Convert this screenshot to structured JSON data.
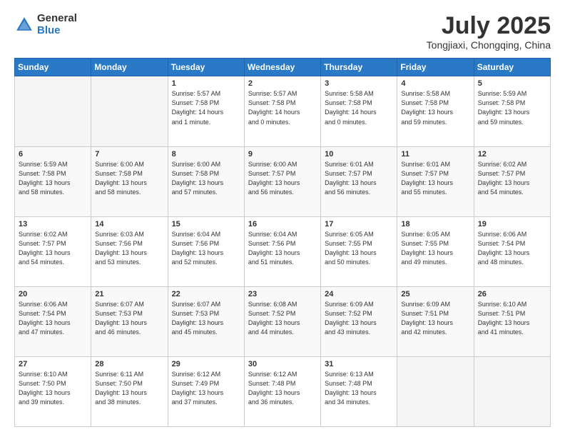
{
  "header": {
    "logo_general": "General",
    "logo_blue": "Blue",
    "month_title": "July 2025",
    "location": "Tongjiaxi, Chongqing, China"
  },
  "weekdays": [
    "Sunday",
    "Monday",
    "Tuesday",
    "Wednesday",
    "Thursday",
    "Friday",
    "Saturday"
  ],
  "weeks": [
    [
      {
        "day": "",
        "text": ""
      },
      {
        "day": "",
        "text": ""
      },
      {
        "day": "1",
        "text": "Sunrise: 5:57 AM\nSunset: 7:58 PM\nDaylight: 14 hours\nand 1 minute."
      },
      {
        "day": "2",
        "text": "Sunrise: 5:57 AM\nSunset: 7:58 PM\nDaylight: 14 hours\nand 0 minutes."
      },
      {
        "day": "3",
        "text": "Sunrise: 5:58 AM\nSunset: 7:58 PM\nDaylight: 14 hours\nand 0 minutes."
      },
      {
        "day": "4",
        "text": "Sunrise: 5:58 AM\nSunset: 7:58 PM\nDaylight: 13 hours\nand 59 minutes."
      },
      {
        "day": "5",
        "text": "Sunrise: 5:59 AM\nSunset: 7:58 PM\nDaylight: 13 hours\nand 59 minutes."
      }
    ],
    [
      {
        "day": "6",
        "text": "Sunrise: 5:59 AM\nSunset: 7:58 PM\nDaylight: 13 hours\nand 58 minutes."
      },
      {
        "day": "7",
        "text": "Sunrise: 6:00 AM\nSunset: 7:58 PM\nDaylight: 13 hours\nand 58 minutes."
      },
      {
        "day": "8",
        "text": "Sunrise: 6:00 AM\nSunset: 7:58 PM\nDaylight: 13 hours\nand 57 minutes."
      },
      {
        "day": "9",
        "text": "Sunrise: 6:00 AM\nSunset: 7:57 PM\nDaylight: 13 hours\nand 56 minutes."
      },
      {
        "day": "10",
        "text": "Sunrise: 6:01 AM\nSunset: 7:57 PM\nDaylight: 13 hours\nand 56 minutes."
      },
      {
        "day": "11",
        "text": "Sunrise: 6:01 AM\nSunset: 7:57 PM\nDaylight: 13 hours\nand 55 minutes."
      },
      {
        "day": "12",
        "text": "Sunrise: 6:02 AM\nSunset: 7:57 PM\nDaylight: 13 hours\nand 54 minutes."
      }
    ],
    [
      {
        "day": "13",
        "text": "Sunrise: 6:02 AM\nSunset: 7:57 PM\nDaylight: 13 hours\nand 54 minutes."
      },
      {
        "day": "14",
        "text": "Sunrise: 6:03 AM\nSunset: 7:56 PM\nDaylight: 13 hours\nand 53 minutes."
      },
      {
        "day": "15",
        "text": "Sunrise: 6:04 AM\nSunset: 7:56 PM\nDaylight: 13 hours\nand 52 minutes."
      },
      {
        "day": "16",
        "text": "Sunrise: 6:04 AM\nSunset: 7:56 PM\nDaylight: 13 hours\nand 51 minutes."
      },
      {
        "day": "17",
        "text": "Sunrise: 6:05 AM\nSunset: 7:55 PM\nDaylight: 13 hours\nand 50 minutes."
      },
      {
        "day": "18",
        "text": "Sunrise: 6:05 AM\nSunset: 7:55 PM\nDaylight: 13 hours\nand 49 minutes."
      },
      {
        "day": "19",
        "text": "Sunrise: 6:06 AM\nSunset: 7:54 PM\nDaylight: 13 hours\nand 48 minutes."
      }
    ],
    [
      {
        "day": "20",
        "text": "Sunrise: 6:06 AM\nSunset: 7:54 PM\nDaylight: 13 hours\nand 47 minutes."
      },
      {
        "day": "21",
        "text": "Sunrise: 6:07 AM\nSunset: 7:53 PM\nDaylight: 13 hours\nand 46 minutes."
      },
      {
        "day": "22",
        "text": "Sunrise: 6:07 AM\nSunset: 7:53 PM\nDaylight: 13 hours\nand 45 minutes."
      },
      {
        "day": "23",
        "text": "Sunrise: 6:08 AM\nSunset: 7:52 PM\nDaylight: 13 hours\nand 44 minutes."
      },
      {
        "day": "24",
        "text": "Sunrise: 6:09 AM\nSunset: 7:52 PM\nDaylight: 13 hours\nand 43 minutes."
      },
      {
        "day": "25",
        "text": "Sunrise: 6:09 AM\nSunset: 7:51 PM\nDaylight: 13 hours\nand 42 minutes."
      },
      {
        "day": "26",
        "text": "Sunrise: 6:10 AM\nSunset: 7:51 PM\nDaylight: 13 hours\nand 41 minutes."
      }
    ],
    [
      {
        "day": "27",
        "text": "Sunrise: 6:10 AM\nSunset: 7:50 PM\nDaylight: 13 hours\nand 39 minutes."
      },
      {
        "day": "28",
        "text": "Sunrise: 6:11 AM\nSunset: 7:50 PM\nDaylight: 13 hours\nand 38 minutes."
      },
      {
        "day": "29",
        "text": "Sunrise: 6:12 AM\nSunset: 7:49 PM\nDaylight: 13 hours\nand 37 minutes."
      },
      {
        "day": "30",
        "text": "Sunrise: 6:12 AM\nSunset: 7:48 PM\nDaylight: 13 hours\nand 36 minutes."
      },
      {
        "day": "31",
        "text": "Sunrise: 6:13 AM\nSunset: 7:48 PM\nDaylight: 13 hours\nand 34 minutes."
      },
      {
        "day": "",
        "text": ""
      },
      {
        "day": "",
        "text": ""
      }
    ]
  ]
}
